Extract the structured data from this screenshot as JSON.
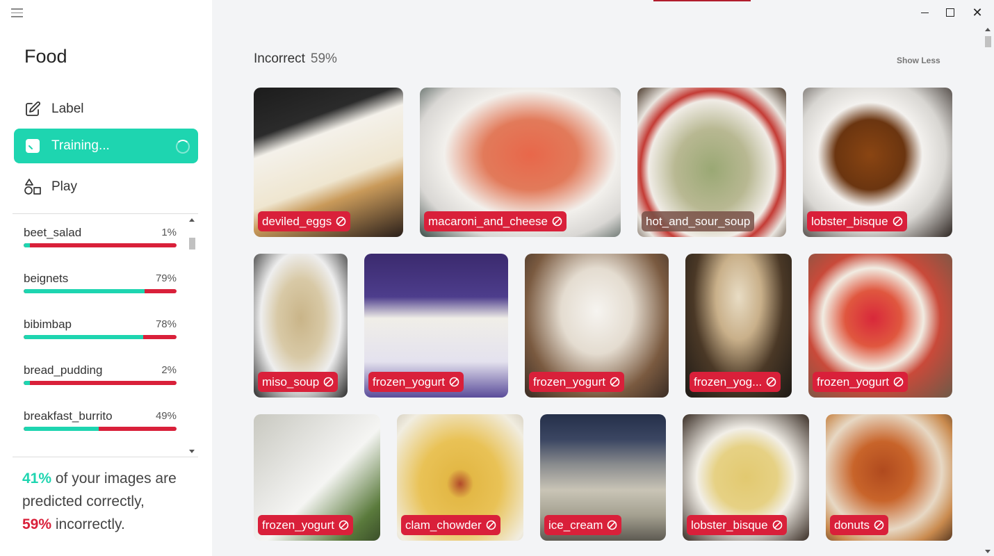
{
  "project": {
    "title": "Food"
  },
  "nav": {
    "label": "Label",
    "training": "Training...",
    "play": "Play"
  },
  "classes": [
    {
      "name": "beet_salad",
      "pct": "1%",
      "correct": 0.01
    },
    {
      "name": "beignets",
      "pct": "79%",
      "correct": 0.79
    },
    {
      "name": "bibimbap",
      "pct": "78%",
      "correct": 0.78
    },
    {
      "name": "bread_pudding",
      "pct": "2%",
      "correct": 0.02
    },
    {
      "name": "breakfast_burrito",
      "pct": "49%",
      "correct": 0.49
    }
  ],
  "summary": {
    "correct_pct": "41%",
    "text1": " of your images are predicted correctly,",
    "incorrect_pct": "59%",
    "text2": " incorrectly."
  },
  "section": {
    "title": "Incorrect",
    "pct": "59%",
    "show_less": "Show Less"
  },
  "tiles": [
    {
      "label": "deviled_eggs"
    },
    {
      "label": "macaroni_and_cheese"
    },
    {
      "label": "hot_and_sour_soup"
    },
    {
      "label": "lobster_bisque"
    },
    {
      "label": "miso_soup"
    },
    {
      "label": "frozen_yogurt"
    },
    {
      "label": "frozen_yogurt"
    },
    {
      "label": "frozen_yog..."
    },
    {
      "label": "frozen_yogurt"
    },
    {
      "label": "frozen_yogurt"
    },
    {
      "label": "clam_chowder"
    },
    {
      "label": "ice_cream"
    },
    {
      "label": "lobster_bisque"
    },
    {
      "label": "donuts"
    }
  ],
  "colors": {
    "accent": "#1ed5b0",
    "error": "#d9203a"
  }
}
